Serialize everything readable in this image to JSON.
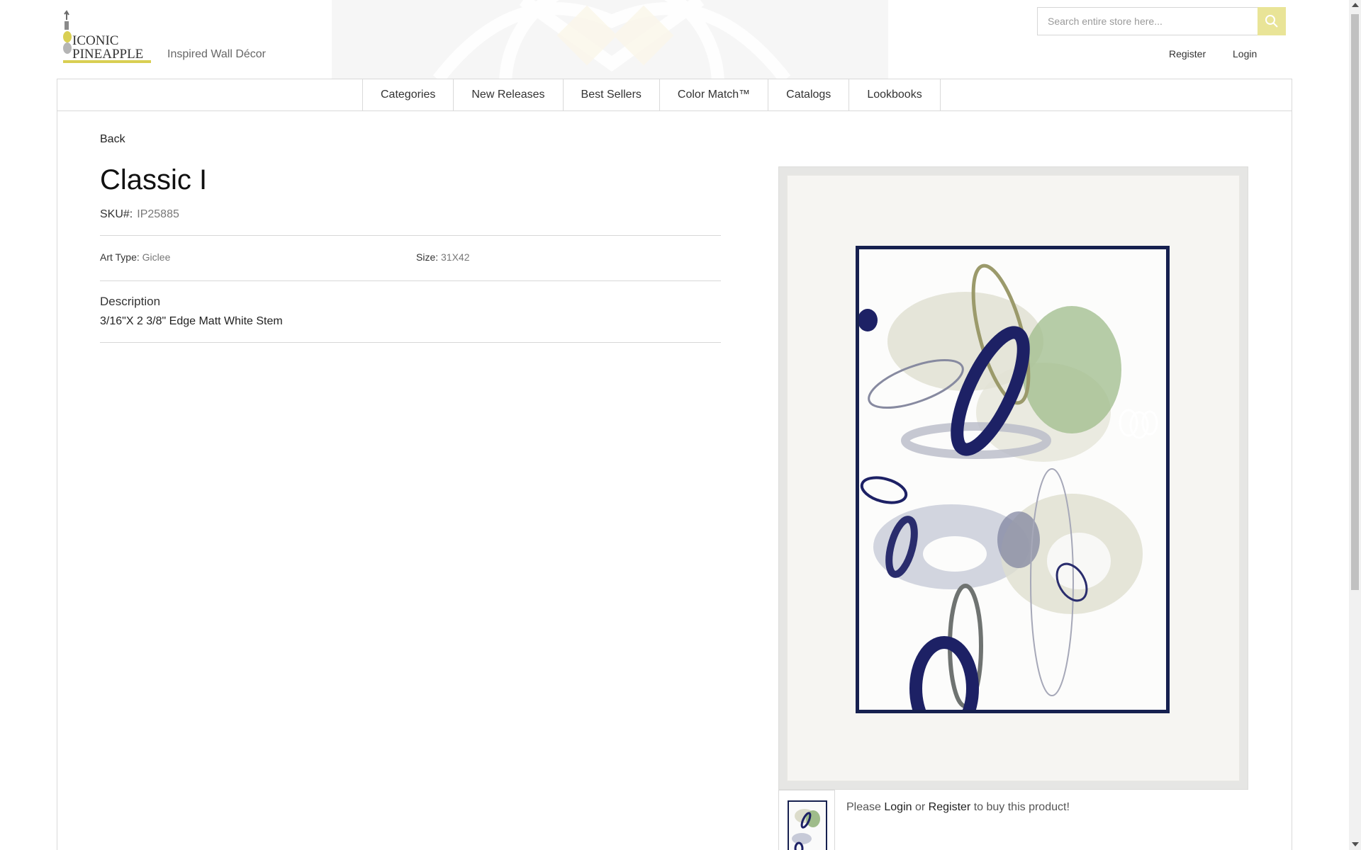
{
  "header": {
    "logo_text_line1": "ICONIC",
    "logo_text_line2": "PINEAPPLE",
    "tagline": "Inspired Wall Décor",
    "search_placeholder": "Search entire store here...",
    "search_icon": "search-icon",
    "register_label": "Register",
    "login_label": "Login",
    "accent_color": "#e9e497"
  },
  "nav": {
    "items": [
      {
        "label": "Categories"
      },
      {
        "label": "New Releases"
      },
      {
        "label": "Best Sellers"
      },
      {
        "label": "Color Match™"
      },
      {
        "label": "Catalogs"
      },
      {
        "label": "Lookbooks"
      }
    ]
  },
  "product": {
    "back_label": "Back",
    "title": "Classic I",
    "sku_label": "SKU#:",
    "sku_value": "IP25885",
    "art_type_label": "Art Type:",
    "art_type_value": "Giclee",
    "size_label": "Size:",
    "size_value": "31X42",
    "description_heading": "Description",
    "description_text": "3/16\"X 2 3/8\" Edge Matt White Stem",
    "frame_color": "#16204f"
  },
  "purchase": {
    "prefix": "Please",
    "login_label": "Login",
    "or_text": "or",
    "register_label": "Register",
    "suffix": "to buy this product!"
  }
}
